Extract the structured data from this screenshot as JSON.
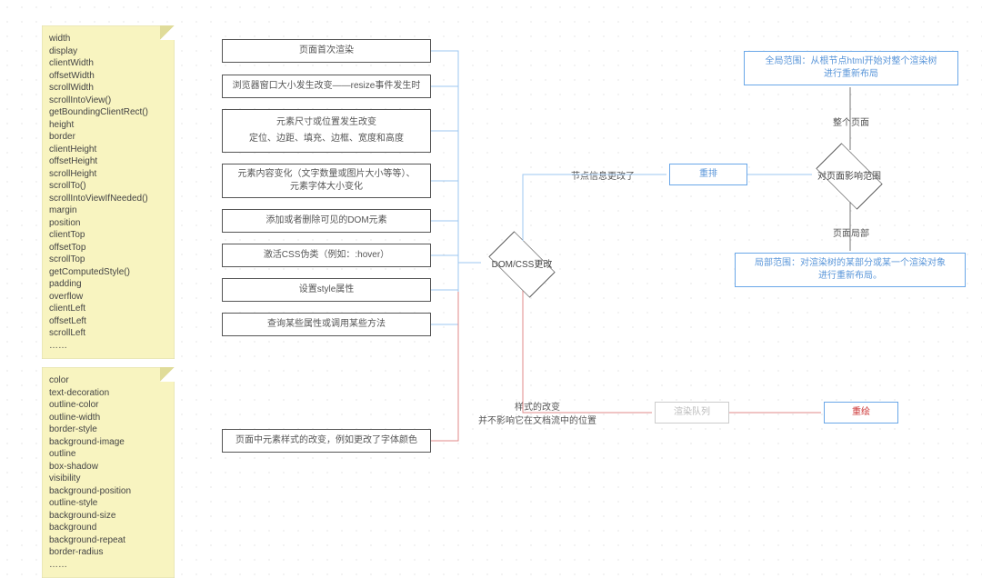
{
  "notes": {
    "top": "width\ndisplay\nclientWidth\noffsetWidth\nscrollWidth\nscrollIntoView()\ngetBoundingClientRect()\nheight\nborder\nclientHeight\noffsetHeight\nscrollHeight\nscrollTo()\nscrollIntoViewIfNeeded()\nmargin\nposition\nclientTop\noffsetTop\nscrollTop\ngetComputedStyle()\npadding\noverflow\nclientLeft\noffsetLeft\nscrollLeft\n……",
    "bottom": "color\ntext-decoration\noutline-color\noutline-width\nborder-style\nbackground-image\noutline\nbox-shadow\nvisibility\nbackground-position\noutline-style\nbackground-size\nbackground\nbackground-repeat\nborder-radius\n……"
  },
  "triggers": {
    "t1": "页面首次渲染",
    "t2": "浏览器窗口大小发生改变——resize事件发生时",
    "t3a": "元素尺寸或位置发生改变",
    "t3b": "定位、边距、填充、边框、宽度和高度",
    "t4": "元素内容变化（文字数量或图片大小等等）、\n元素字体大小变化",
    "t5": "添加或者删除可见的DOM元素",
    "t6": "激活CSS伪类（例如：:hover）",
    "t7": "设置style属性",
    "t8": "查询某些属性或调用某些方法",
    "style": "页面中元素样式的改变，例如更改了字体颜色"
  },
  "flow": {
    "domcss": "DOM/CSS更改",
    "nodeChanged": "节点信息更改了",
    "styleChanged": "样式的改变\n并不影响它在文档流中的位置",
    "reflow": "重排",
    "repaintQueue": "渲染队列",
    "repaint": "重绘",
    "scope": "对页面影响范围",
    "wholePage": "整个页面",
    "pagePart": "页面局部",
    "globalScope": "全局范围：从根节点html开始对整个渲染树\n进行重新布局",
    "localScope": "局部范围：对渲染树的某部分或某一个渲染对象\n进行重新布局。"
  }
}
